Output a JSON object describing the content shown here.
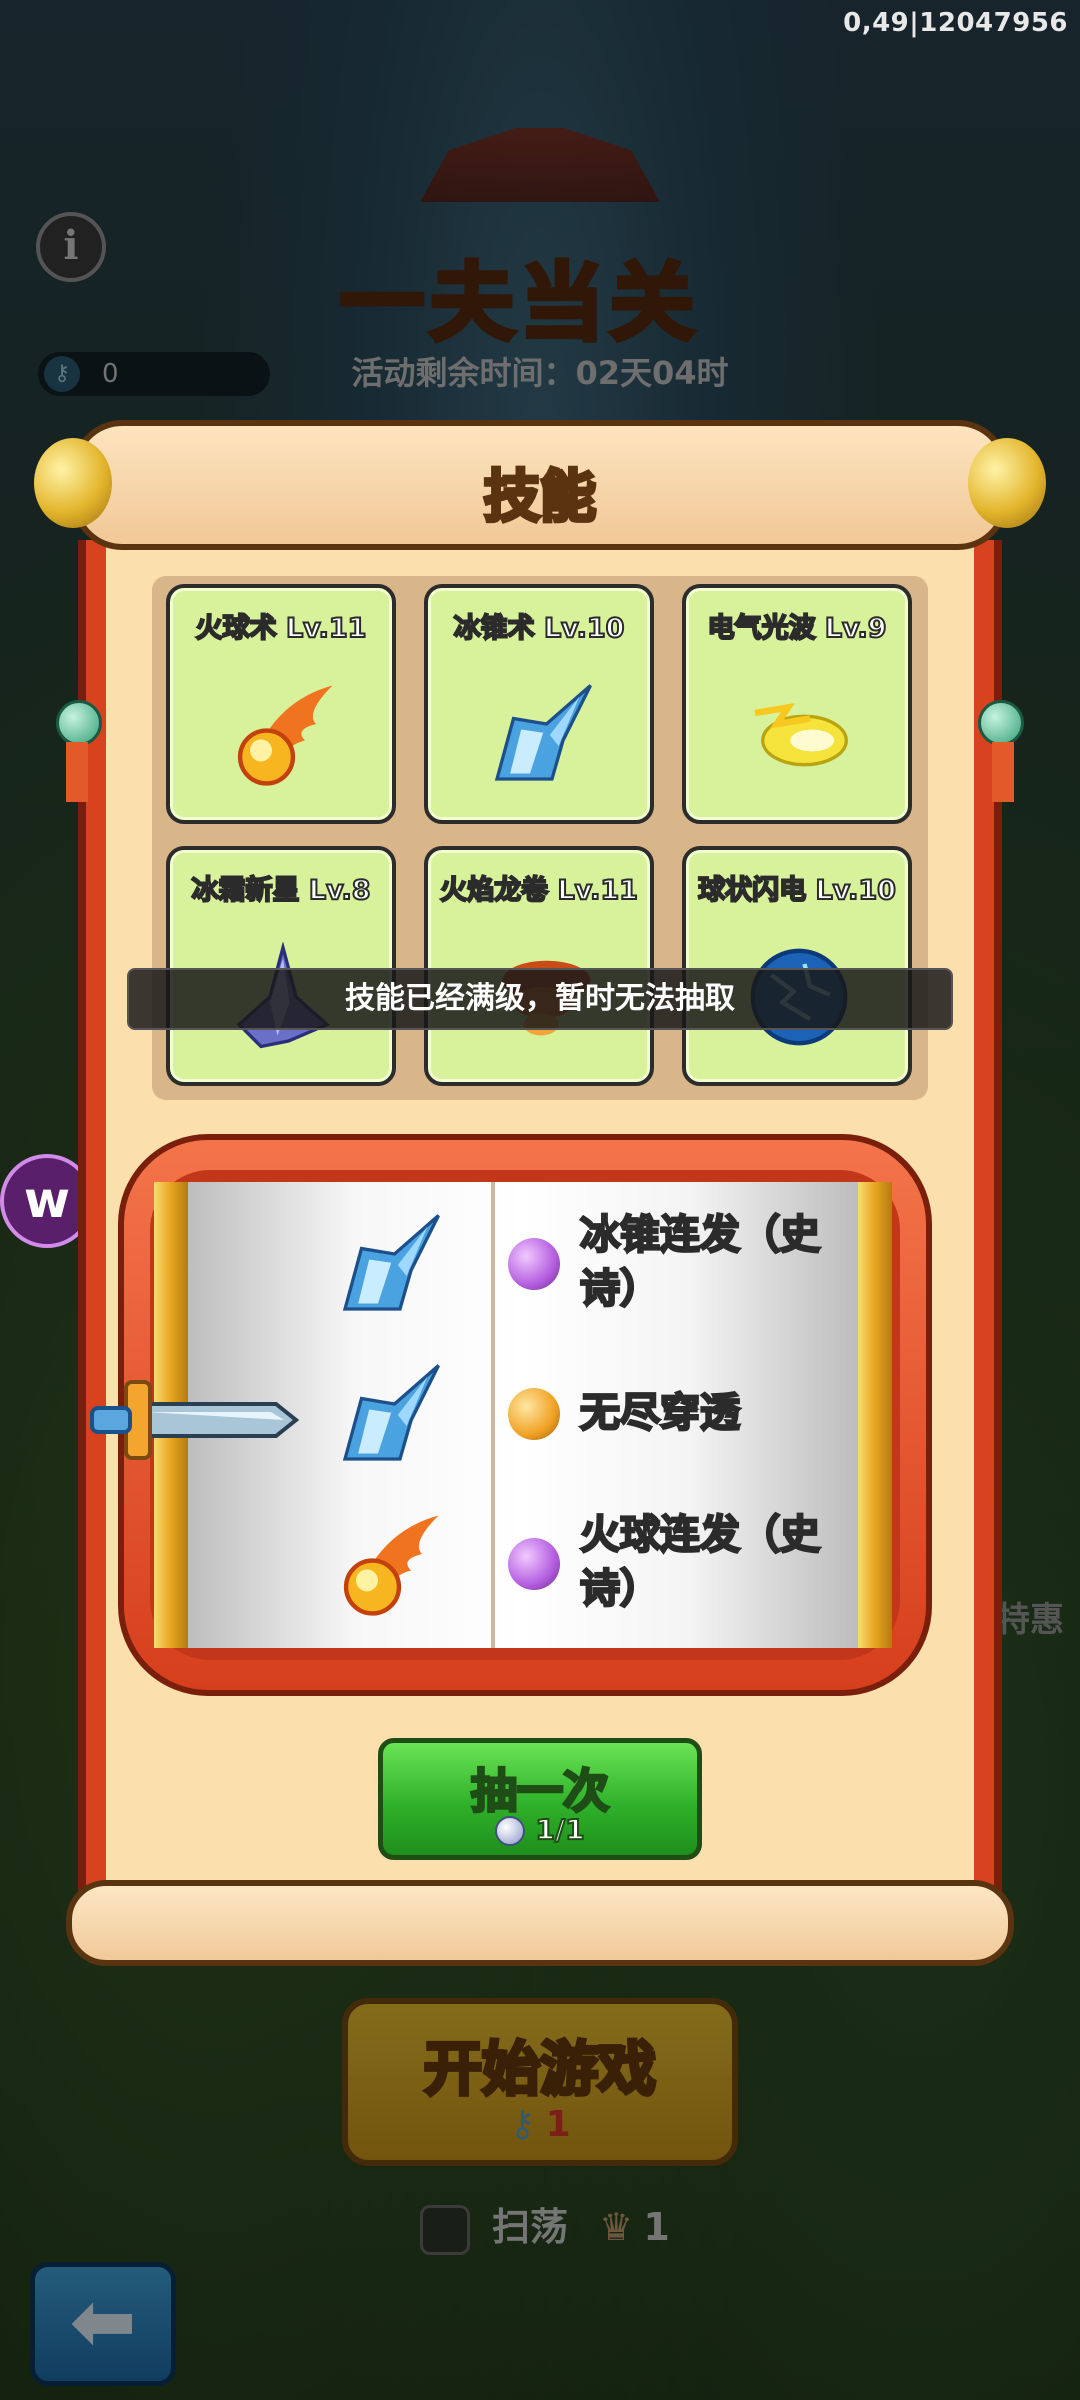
{
  "status": {
    "debug_info": "0,49|12047956"
  },
  "background": {
    "game_title": "一夫当关",
    "timer_text": "活动剩余时间：02天04时",
    "resource_count": "0",
    "side_promo_text": "特惠",
    "start_button": {
      "label": "开始游戏",
      "cost": "1"
    },
    "sweep": {
      "label": "扫荡",
      "count": "1"
    },
    "back_icon": "arrow-left-icon"
  },
  "skills_panel": {
    "title": "技能",
    "skills": [
      {
        "name": "火球术 Lv.11",
        "icon": "fireball-icon"
      },
      {
        "name": "冰锥术 Lv.10",
        "icon": "ice-shard-icon"
      },
      {
        "name": "电气光波 Lv.9",
        "icon": "lightning-wave-icon"
      },
      {
        "name": "冰霜新星 Lv.8",
        "icon": "frost-nova-icon"
      },
      {
        "name": "火焰龙卷 Lv.11",
        "icon": "fire-tornado-icon"
      },
      {
        "name": "球状闪电 Lv.10",
        "icon": "ball-lightning-icon"
      }
    ],
    "toast": "技能已经满级，暂时无法抽取",
    "slot_items": [
      {
        "icon": "ice-shard-icon",
        "gem": "purple",
        "label": "冰锥连发（史诗）"
      },
      {
        "icon": "ice-shard-icon",
        "gem": "orange",
        "label": "无尽穿透"
      },
      {
        "icon": "fireball-icon",
        "gem": "purple",
        "label": "火球连发（史诗）"
      }
    ],
    "draw_button": {
      "label": "抽一次",
      "cost": "1/1"
    }
  },
  "colors": {
    "gem_purple": "#b45ee0",
    "gem_orange": "#f0a224",
    "card_bg": "#d8f29b"
  }
}
